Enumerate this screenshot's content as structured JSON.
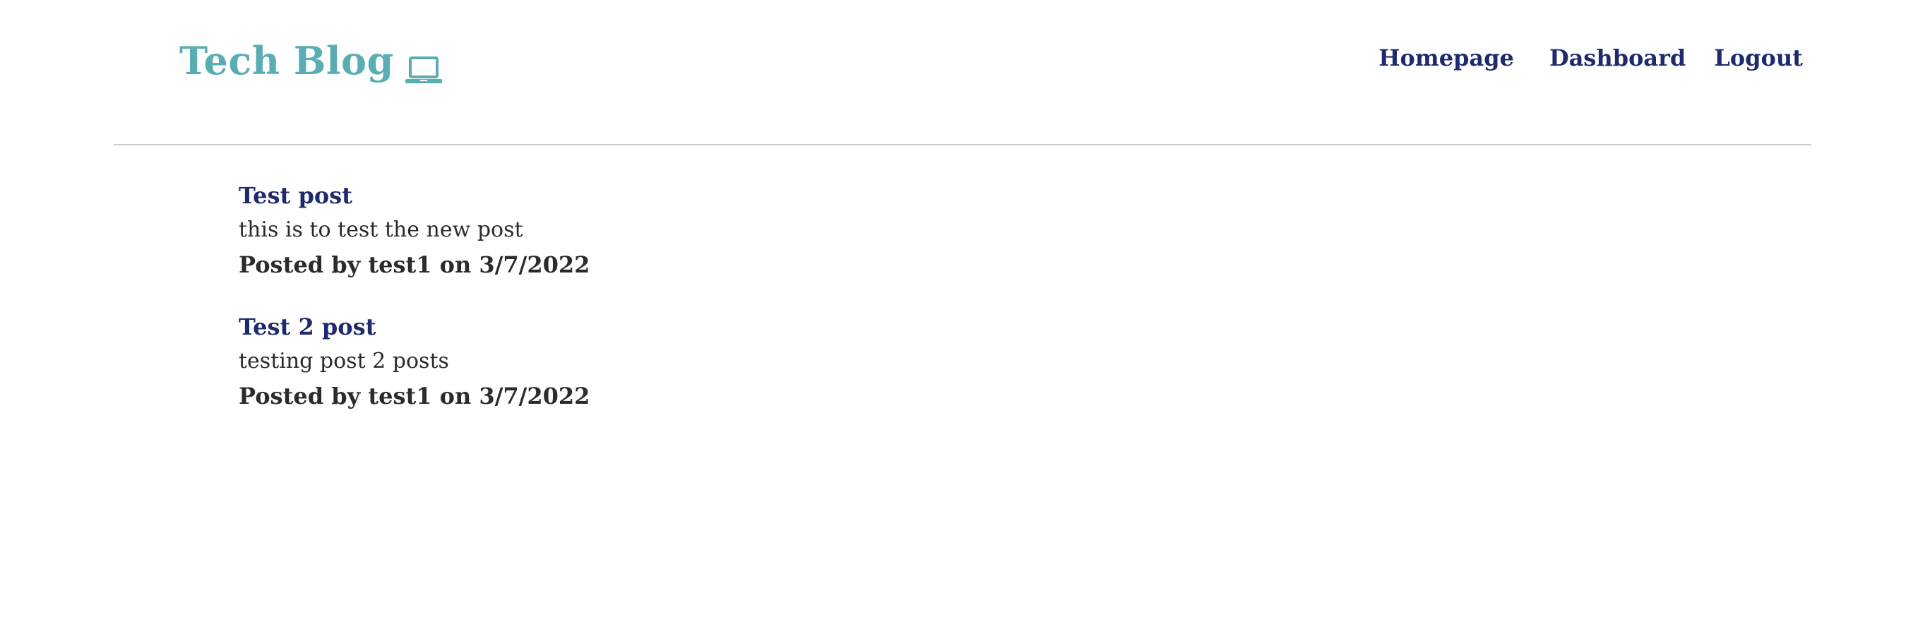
{
  "header": {
    "brand_title": "Tech Blog",
    "brand_icon": "laptop-icon",
    "brand_color": "#5aaeb3"
  },
  "nav": {
    "homepage": "Homepage",
    "dashboard": "Dashboard",
    "logout": "Logout",
    "link_color": "#1e2a6b"
  },
  "posts": [
    {
      "title": "Test post",
      "body": "this is to test the new post",
      "meta": "Posted by test1 on 3/7/2022"
    },
    {
      "title": "Test 2 post",
      "body": "testing post 2 posts",
      "meta": "Posted by test1 on 3/7/2022"
    }
  ]
}
